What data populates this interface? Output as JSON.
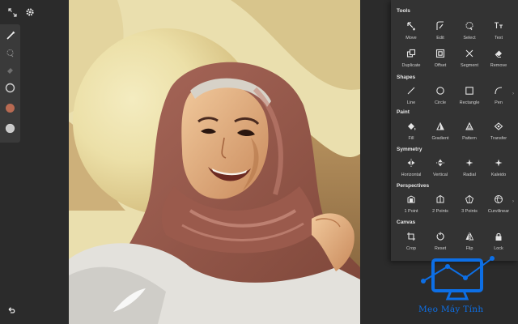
{
  "app": {
    "top_icons": [
      "collapse-arrows-icon",
      "gear-icon"
    ],
    "undo_icon": "undo-icon"
  },
  "left_toolbar": {
    "items": [
      {
        "name": "brush-icon"
      },
      {
        "name": "lasso-select-icon"
      },
      {
        "name": "eraser-icon"
      },
      {
        "name": "brush-size-icon"
      },
      {
        "name": "color-swatch",
        "color": "#b86a52"
      },
      {
        "name": "brush-opacity-icon"
      }
    ]
  },
  "tools_panel": {
    "sections": [
      {
        "title": "Tools",
        "items": [
          {
            "label": "Move",
            "icon": "move-icon"
          },
          {
            "label": "Edit",
            "icon": "edit-icon"
          },
          {
            "label": "Select",
            "icon": "select-icon"
          },
          {
            "label": "Text",
            "icon": "text-icon"
          },
          {
            "label": "Duplicate",
            "icon": "duplicate-icon"
          },
          {
            "label": "Offset",
            "icon": "offset-icon"
          },
          {
            "label": "Segment",
            "icon": "segment-icon"
          },
          {
            "label": "Remove",
            "icon": "remove-icon"
          }
        ]
      },
      {
        "title": "Shapes",
        "items": [
          {
            "label": "Line",
            "icon": "line-icon"
          },
          {
            "label": "Circle",
            "icon": "circle-icon"
          },
          {
            "label": "Rectangle",
            "icon": "rectangle-icon"
          },
          {
            "label": "Pen",
            "icon": "pen-icon"
          }
        ]
      },
      {
        "title": "Paint",
        "items": [
          {
            "label": "Fill",
            "icon": "fill-icon"
          },
          {
            "label": "Gradient",
            "icon": "gradient-icon"
          },
          {
            "label": "Pattern",
            "icon": "pattern-icon"
          },
          {
            "label": "Transfer",
            "icon": "transfer-icon"
          }
        ]
      },
      {
        "title": "Symmetry",
        "items": [
          {
            "label": "Horizontal",
            "icon": "horizontal-symmetry-icon"
          },
          {
            "label": "Vertical",
            "icon": "vertical-symmetry-icon"
          },
          {
            "label": "Radial",
            "icon": "radial-symmetry-icon"
          },
          {
            "label": "Kaleido",
            "icon": "kaleido-icon"
          }
        ]
      },
      {
        "title": "Perspectives",
        "items": [
          {
            "label": "1 Point",
            "icon": "one-point-icon"
          },
          {
            "label": "2 Points",
            "icon": "two-points-icon"
          },
          {
            "label": "3 Points",
            "icon": "three-points-icon"
          },
          {
            "label": "Curvilinear",
            "icon": "curvilinear-icon"
          }
        ]
      },
      {
        "title": "Canvas",
        "items": [
          {
            "label": "Crop",
            "icon": "crop-icon"
          },
          {
            "label": "Reset",
            "icon": "reset-icon"
          },
          {
            "label": "Flip",
            "icon": "flip-icon"
          },
          {
            "label": "Lock",
            "icon": "lock-icon"
          }
        ]
      }
    ]
  },
  "watermark": {
    "text": "Mẹo Máy Tính",
    "color": "#0d6fe6"
  }
}
